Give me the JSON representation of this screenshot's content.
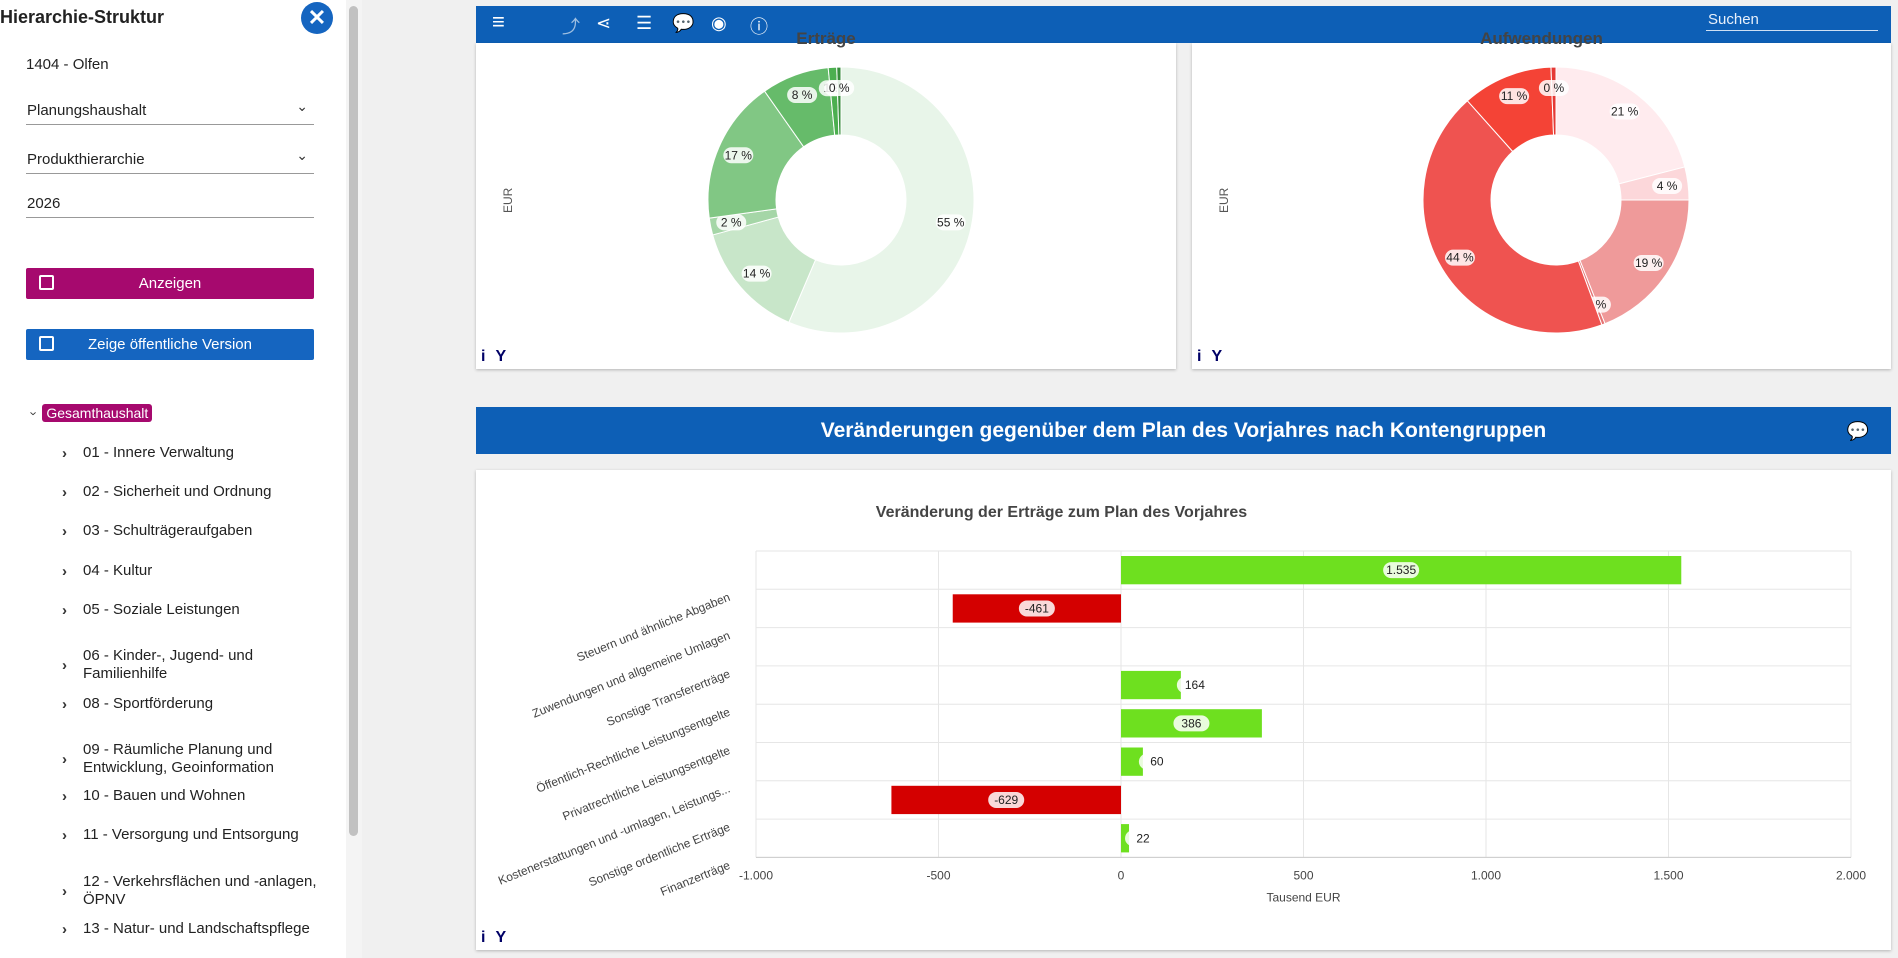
{
  "sidebar": {
    "title": "Hierarchie-Struktur",
    "municipality": "1404 - Olfen",
    "select_budget": "Planungshaushalt",
    "select_hierarchy": "Produkthierarchie",
    "year": "2026",
    "show_button": "Anzeigen",
    "public_button": "Zeige öffentliche Version",
    "tree_root": "Gesamthaushalt",
    "tree_items": [
      "01 - Innere Verwaltung",
      "02 - Sicherheit und Ordnung",
      "03 - Schulträgeraufgaben",
      "04 - Kultur",
      "05 - Soziale Leistungen",
      "06 - Kinder-, Jugend- und Familienhilfe",
      "08 - Sportförderung",
      "09 - Räumliche Planung und Entwicklung, Geoinformation",
      "10 - Bauen und Wohnen",
      "11 - Versorgung und Entsorgung",
      "12 - Verkehrsflächen und -anlagen, ÖPNV",
      "13 - Natur- und Landschaftspflege"
    ]
  },
  "toolbar": {
    "search_placeholder": "Suchen",
    "icons": [
      "menu-icon",
      "share-up-icon",
      "share-icon",
      "list-icon",
      "comments-icon",
      "eye-icon",
      "info-icon"
    ]
  },
  "section_header": "Veränderungen gegenüber dem Plan des Vorjahres nach Kontengruppen",
  "chart_data": [
    {
      "type": "pie",
      "title": "Erträge",
      "ylabel": "EUR",
      "labels": [
        "55 %",
        "14 %",
        "2 %",
        "17 %",
        "8 %",
        "1 %",
        "0 %"
      ],
      "values": [
        55,
        14,
        2,
        17,
        8,
        1,
        0.5
      ],
      "colors": [
        "#e8f5e9",
        "#c8e6c9",
        "#a5d6a7",
        "#81c784",
        "#66bb6a",
        "#4caf50",
        "#388e3c"
      ]
    },
    {
      "type": "pie",
      "title": "Aufwendungen",
      "ylabel": "EUR",
      "labels": [
        "21 %",
        "4 %",
        "19 %",
        "0 %",
        "44 %",
        "11 %",
        "0 %"
      ],
      "values": [
        21,
        4,
        19,
        0.4,
        44,
        11,
        0.6
      ],
      "colors": [
        "#ffebee",
        "#fcd7da",
        "#ef9a9a",
        "#e57373",
        "#ef5350",
        "#f44336",
        "#e53935"
      ]
    },
    {
      "type": "bar",
      "orientation": "horizontal",
      "title": "Veränderung der Erträge zum Plan des Vorjahres",
      "xlabel": "Tausend EUR",
      "xlim": [
        -1000,
        2000
      ],
      "xticks": [
        "-1.000",
        "-500",
        "0",
        "500",
        "1.000",
        "1.500",
        "2.000"
      ],
      "categories": [
        "Steuern und ähnliche Abgaben",
        "Zuwendungen und allgemeine Umlagen",
        "Sonstige Transfererträge",
        "Öffentlich-Rechtliche Leistungsentgelte",
        "Privatrechtliche Leistungsentgelte",
        "Kostenerstattungen und -umlagen, Leistungs...",
        "Sonstige ordentliche Erträge",
        "Finanzerträge"
      ],
      "values": [
        1535,
        -461,
        0,
        164,
        386,
        60,
        -629,
        22
      ],
      "value_labels": [
        "1.535",
        "-461",
        "",
        "164",
        "386",
        "60",
        "-629",
        "22"
      ],
      "positive_color": "#6ee01f",
      "negative_color": "#d40000"
    }
  ]
}
